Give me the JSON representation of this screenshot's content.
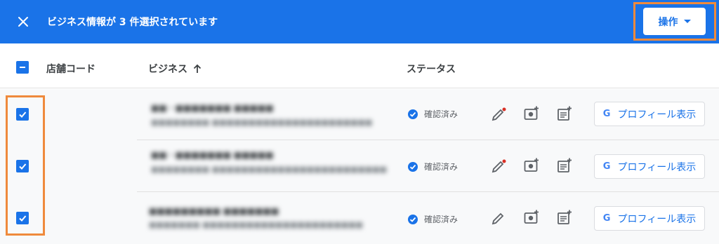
{
  "topbar": {
    "title": "ビジネス情報が 3 件選択されています",
    "actions_label": "操作"
  },
  "header": {
    "store_code": "店舗コード",
    "business": "ビジネス",
    "status": "ステータス"
  },
  "rows": [
    {
      "status": "確認済み",
      "profile_label": "プロフィール表示",
      "google_letter": "G",
      "business_name": "■■・■■■■■■■ ■■■■■",
      "business_address": "■■■■■■■■ ■■■■■■■■■■■■■■■■■■■■■■"
    },
    {
      "status": "確認済み",
      "profile_label": "プロフィール表示",
      "google_letter": "G",
      "business_name": "■■・■■■■■■■ ■■■■■",
      "business_address": "■■■■■■■■ ■■■■■■■■■■■■■■■■■■■■■■■■"
    },
    {
      "status": "確認済み",
      "profile_label": "プロフィール表示",
      "google_letter": "G",
      "business_name": "■■■■■■■■■ ■■■■■■■",
      "business_address": "■■■■■■■ ■■■■■■■■■■■■■■■■■■■■■■"
    }
  ],
  "colors": {
    "accent": "#1a73e8",
    "highlight": "#ef8a3c",
    "edit_dot": "#d93025"
  }
}
